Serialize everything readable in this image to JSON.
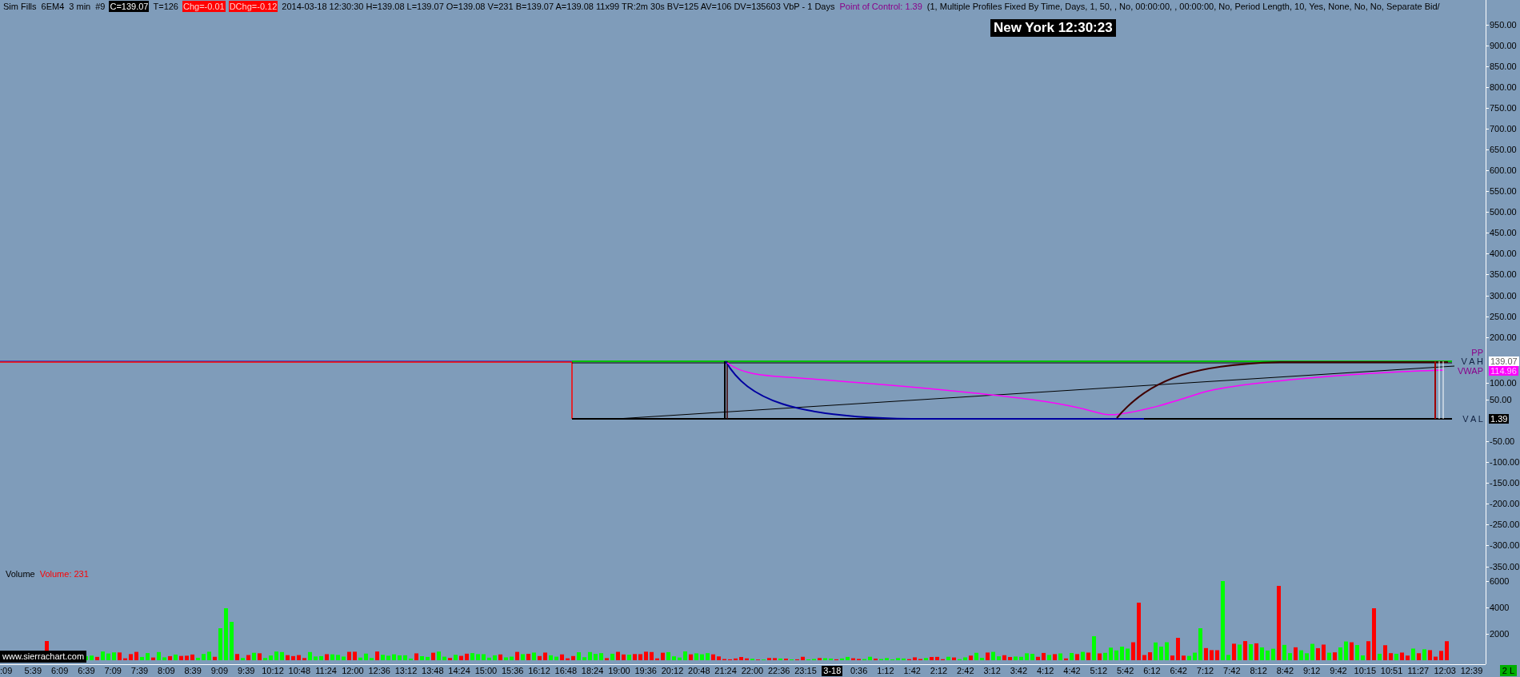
{
  "header": [
    {
      "text": "Sim Fills",
      "kind": "plain"
    },
    {
      "text": "6EM4",
      "kind": "plain"
    },
    {
      "text": "3 min",
      "kind": "plain"
    },
    {
      "text": "#9",
      "kind": "plain"
    },
    {
      "text": "C=139.07",
      "kind": "inverse"
    },
    {
      "text": "T=126",
      "kind": "plain"
    },
    {
      "text": "Chg=-0.01",
      "kind": "alert"
    },
    {
      "text": "DChg=-0.12",
      "kind": "alert"
    },
    {
      "text": "2014-03-18 12:30:30 H=139.08 L=139.07 O=139.08 V=231 B=139.07 A=139.08 11x99 TR:2m 30s BV=125 AV=106 DV=135603 VbP - 1 Days",
      "kind": "plain"
    },
    {
      "text": "Point of Control: 1.39",
      "kind": "study"
    },
    {
      "text": "(1, Multiple Profiles Fixed By Time, Days, 1, 50, , No, 00:00:00, , 00:00:00, No, Period Length, 10, Yes, None, No, No, Separate Bid/",
      "kind": "plain"
    }
  ],
  "clock": "New York 12:30:23",
  "price_axis": [
    "950.00",
    "900.00",
    "850.00",
    "800.00",
    "750.00",
    "700.00",
    "650.00",
    "600.00",
    "550.00",
    "500.00",
    "450.00",
    "400.00",
    "350.00",
    "300.00",
    "250.00",
    "200.00",
    "100.00",
    "50.00",
    "-50.00",
    "-100.00",
    "-150.00",
    "-200.00",
    "-250.00",
    "-300.00",
    "-350.00"
  ],
  "study_markers": [
    {
      "kind": "pp",
      "label": "PP"
    },
    {
      "kind": "vah",
      "label": "V A H",
      "value": "139.07"
    },
    {
      "kind": "vwap",
      "label": "VWAP",
      "value": "114.96"
    },
    {
      "kind": "val",
      "label": "V A L",
      "value": "1.39"
    }
  ],
  "volume_pane": {
    "title": "Volume",
    "reading": "Volume: 231",
    "axis": [
      "6000",
      "4000",
      "2000"
    ]
  },
  "watermark": "www.sierrachart.com",
  "time_axis": [
    {
      "text": ":09",
      "kind": "time"
    },
    {
      "text": "5:39",
      "kind": "time"
    },
    {
      "text": "6:09",
      "kind": "time"
    },
    {
      "text": "6:39",
      "kind": "time"
    },
    {
      "text": "7:09",
      "kind": "time"
    },
    {
      "text": "7:39",
      "kind": "time"
    },
    {
      "text": "8:09",
      "kind": "time"
    },
    {
      "text": "8:39",
      "kind": "time"
    },
    {
      "text": "9:09",
      "kind": "time"
    },
    {
      "text": "9:39",
      "kind": "time"
    },
    {
      "text": "10:12",
      "kind": "time"
    },
    {
      "text": "10:48",
      "kind": "time"
    },
    {
      "text": "11:24",
      "kind": "time"
    },
    {
      "text": "12:00",
      "kind": "time"
    },
    {
      "text": "12:36",
      "kind": "time"
    },
    {
      "text": "13:12",
      "kind": "time"
    },
    {
      "text": "13:48",
      "kind": "time"
    },
    {
      "text": "14:24",
      "kind": "time"
    },
    {
      "text": "15:00",
      "kind": "time"
    },
    {
      "text": "15:36",
      "kind": "time"
    },
    {
      "text": "16:12",
      "kind": "time"
    },
    {
      "text": "16:48",
      "kind": "time"
    },
    {
      "text": "18:24",
      "kind": "time"
    },
    {
      "text": "19:00",
      "kind": "time"
    },
    {
      "text": "19:36",
      "kind": "time"
    },
    {
      "text": "20:12",
      "kind": "time"
    },
    {
      "text": "20:48",
      "kind": "time"
    },
    {
      "text": "21:24",
      "kind": "time"
    },
    {
      "text": "22:00",
      "kind": "time"
    },
    {
      "text": "22:36",
      "kind": "time"
    },
    {
      "text": "23:15",
      "kind": "time"
    },
    {
      "text": "3-18",
      "kind": "date"
    },
    {
      "text": "0:36",
      "kind": "time"
    },
    {
      "text": "1:12",
      "kind": "time"
    },
    {
      "text": "1:42",
      "kind": "time"
    },
    {
      "text": "2:12",
      "kind": "time"
    },
    {
      "text": "2:42",
      "kind": "time"
    },
    {
      "text": "3:12",
      "kind": "time"
    },
    {
      "text": "3:42",
      "kind": "time"
    },
    {
      "text": "4:12",
      "kind": "time"
    },
    {
      "text": "4:42",
      "kind": "time"
    },
    {
      "text": "5:12",
      "kind": "time"
    },
    {
      "text": "5:42",
      "kind": "time"
    },
    {
      "text": "6:12",
      "kind": "time"
    },
    {
      "text": "6:42",
      "kind": "time"
    },
    {
      "text": "7:12",
      "kind": "time"
    },
    {
      "text": "7:42",
      "kind": "time"
    },
    {
      "text": "8:12",
      "kind": "time"
    },
    {
      "text": "8:42",
      "kind": "time"
    },
    {
      "text": "9:12",
      "kind": "time"
    },
    {
      "text": "9:42",
      "kind": "time"
    },
    {
      "text": "10:15",
      "kind": "time"
    },
    {
      "text": "10:51",
      "kind": "time"
    },
    {
      "text": "11:27",
      "kind": "time"
    },
    {
      "text": "12:03",
      "kind": "time"
    },
    {
      "text": "12:39",
      "kind": "time"
    }
  ],
  "status": "2 L"
}
